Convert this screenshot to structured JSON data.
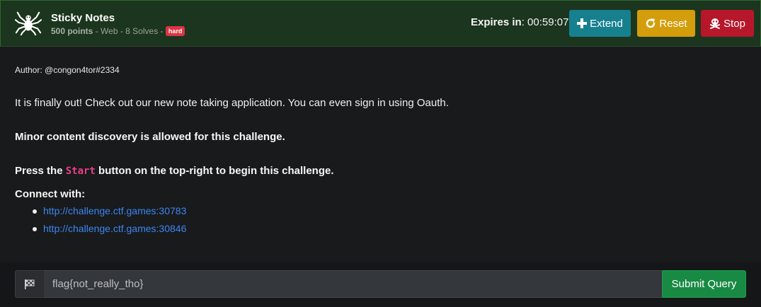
{
  "challenge": {
    "title": "Sticky Notes",
    "points": "500 points",
    "category": "Web",
    "solves": "8 Solves",
    "difficulty": "hard",
    "separator": " - "
  },
  "timer": {
    "label": "Expires in",
    "colon": ":",
    "value": "00:59:07"
  },
  "buttons": {
    "extend": "Extend",
    "reset": "Reset",
    "stop": "Stop"
  },
  "description": {
    "author": "Author: @congon4tor#2334",
    "intro": "It is finally out! Check out our new note taking application. You can even sign in using Oauth.",
    "minor": "Minor content discovery is allowed for this challenge.",
    "press_before": "Press the ",
    "press_code": "Start",
    "press_after": " button on the top-right to begin this challenge.",
    "connect_label": "Connect with:",
    "links": [
      "http://challenge.ctf.games:30783",
      "http://challenge.ctf.games:30846"
    ]
  },
  "flag_form": {
    "value": "flag{not_really_tho}",
    "submit": "Submit Query"
  },
  "colors": {
    "header_bg": "#1c351e",
    "extend": "#17808f",
    "reset": "#d49d0b",
    "stop": "#b7172b",
    "submit": "#198a43",
    "link": "#3b86f0",
    "code": "#e83e8c",
    "badge": "#dc3545"
  },
  "icons": {
    "logo": "spider-icon",
    "extend": "plus-icon",
    "reset": "redo-icon",
    "stop": "skull-crossbones-icon",
    "flag": "checkered-flag-icon"
  }
}
